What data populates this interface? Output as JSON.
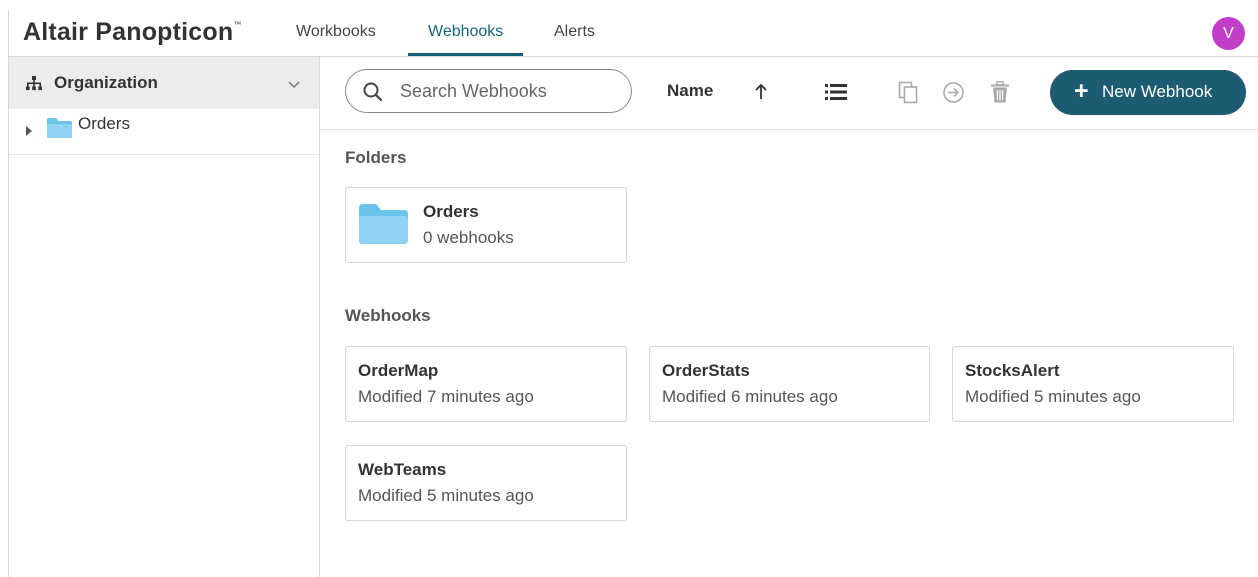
{
  "header": {
    "brand": "Altair Panopticon",
    "brand_mark": "™",
    "tabs": [
      {
        "label": "Workbooks",
        "active": false
      },
      {
        "label": "Webhooks",
        "active": true
      },
      {
        "label": "Alerts",
        "active": false
      }
    ],
    "avatar_initial": "V",
    "avatar_color": "#c23ec8",
    "accent_color": "#1a5f7a"
  },
  "sidebar": {
    "header_icon": "hierarchy-icon",
    "header_label": "Organization",
    "tree": [
      {
        "label": "Orders",
        "icon": "folder-icon",
        "expanded": false
      }
    ]
  },
  "toolbar": {
    "search_placeholder": "Search Webhooks",
    "sort_field": "Name",
    "sort_direction_icon": "arrow-up-icon",
    "view_icon": "list-view-icon",
    "action_icons": [
      "copy-icon",
      "move-icon",
      "trash-icon"
    ],
    "new_button_label": "New Webhook",
    "new_button_color": "#1d5b73"
  },
  "main": {
    "folders_title": "Folders",
    "folders": [
      {
        "name": "Orders",
        "count": "0 webhooks"
      }
    ],
    "webhooks_title": "Webhooks",
    "webhooks": [
      {
        "name": "OrderMap",
        "modified": "Modified 7 minutes ago"
      },
      {
        "name": "OrderStats",
        "modified": "Modified 6 minutes ago"
      },
      {
        "name": "StocksAlert",
        "modified": "Modified 5 minutes ago"
      },
      {
        "name": "WebTeams",
        "modified": "Modified 5 minutes ago"
      }
    ]
  }
}
